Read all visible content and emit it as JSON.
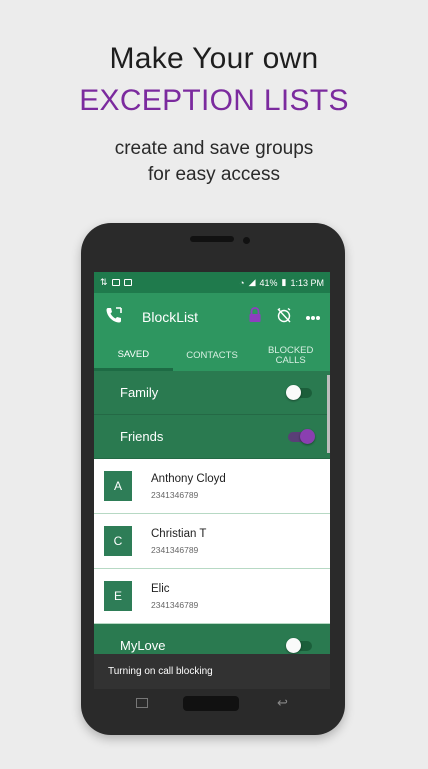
{
  "promo": {
    "title": "Make Your own",
    "subtitle": "EXCEPTION LISTS",
    "description_line1": "create and save groups",
    "description_line2": "for easy access"
  },
  "statusbar": {
    "battery": "41%",
    "time": "1:13 PM"
  },
  "appbar": {
    "title": "BlockList",
    "icons": [
      "phone-forward-icon",
      "lock-icon",
      "alarm-off-icon",
      "more-vert-icon"
    ]
  },
  "tabs": [
    {
      "label": "SAVED",
      "active": true
    },
    {
      "label": "CONTACTS",
      "active": false
    },
    {
      "label_line1": "BLOCKED",
      "label_line2": "CALLS",
      "active": false
    }
  ],
  "groups": {
    "family": {
      "label": "Family",
      "enabled": false
    },
    "friends": {
      "label": "Friends",
      "enabled": true
    },
    "mylove": {
      "label": "MyLove",
      "enabled": false
    }
  },
  "contacts": [
    {
      "initial": "A",
      "name": "Anthony Cloyd",
      "phone": "2341346789"
    },
    {
      "initial": "C",
      "name": "Christian T",
      "phone": "2341346789"
    },
    {
      "initial": "E",
      "name": "Elic",
      "phone": "2341346789"
    }
  ],
  "snackbar": {
    "message": "Turning on call blocking"
  },
  "colors": {
    "appbar": "#2e9660",
    "statusbar": "#1f7a4c",
    "group_row": "#2a7a50",
    "accent_purple": "#7b2a9e",
    "avatar": "#2e7d57"
  }
}
